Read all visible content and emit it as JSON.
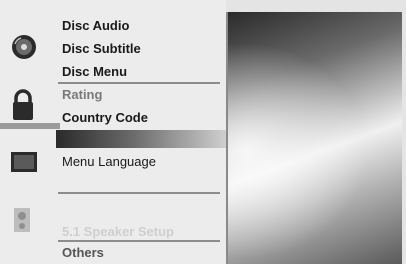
{
  "menu": {
    "groups": [
      {
        "icon": "disc-icon",
        "items": [
          "Disc Audio",
          "Disc Subtitle",
          "Disc Menu"
        ]
      },
      {
        "icon": "lock-icon",
        "items": [
          "Rating",
          "Country Code"
        ]
      },
      {
        "icon": "monitor-icon",
        "items": [
          "Menu Language"
        ]
      },
      {
        "icon": "speaker-icon",
        "items": [
          "5.1 Speaker Setup"
        ]
      },
      {
        "icon": "",
        "items": [
          "Others"
        ]
      }
    ]
  }
}
